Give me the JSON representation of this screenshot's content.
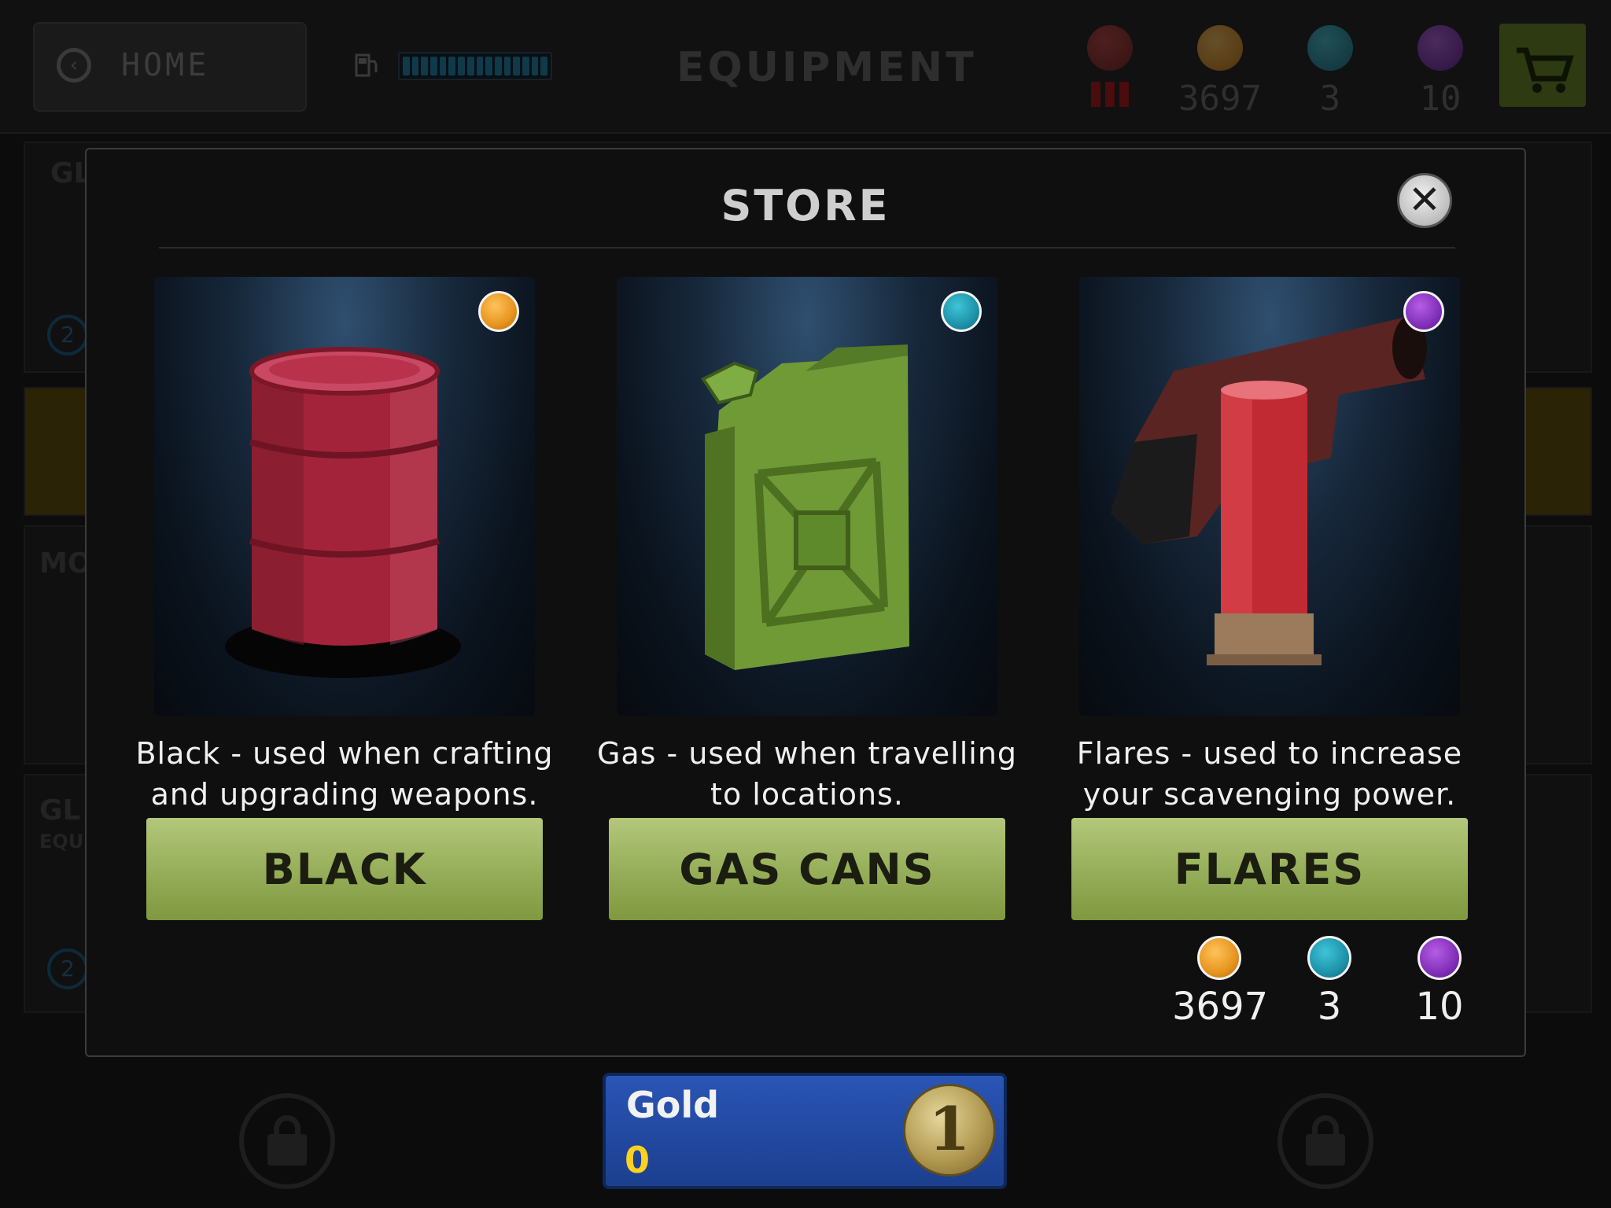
{
  "header": {
    "home_label": "HOME",
    "screen_title": "EQUIPMENT",
    "resources": [
      {
        "icon": "skull-icon",
        "value": ""
      },
      {
        "icon": "black-oil-drop-icon",
        "value": "3697"
      },
      {
        "icon": "gas-can-icon",
        "value": "3"
      },
      {
        "icon": "flare-gun-icon",
        "value": "10"
      }
    ]
  },
  "background": {
    "labels": [
      "GL",
      "MO",
      "GL",
      "EQU"
    ],
    "badge_numbers": [
      "2",
      "2"
    ],
    "gold_panel": {
      "title": "Gold",
      "amount": "0",
      "coin_label": "1"
    }
  },
  "store": {
    "title": "STORE",
    "close_symbol": "✕",
    "cards": [
      {
        "icon": "black-oil-drop-icon",
        "image": "oil-barrel",
        "description_line1": "Black - used when crafting",
        "description_line2": "and upgrading weapons.",
        "button_label": "BLACK"
      },
      {
        "icon": "gas-can-icon",
        "image": "jerry-can",
        "description_line1": "Gas - used when travelling",
        "description_line2": "to locations.",
        "button_label": "GAS CANS"
      },
      {
        "icon": "flare-gun-icon",
        "image": "flare-gun",
        "description_line1": "Flares - used to increase",
        "description_line2": "your scavenging power.",
        "button_label": "FLARES"
      }
    ],
    "balances": [
      {
        "icon": "black-oil-drop-icon",
        "value": "3697"
      },
      {
        "icon": "gas-can-icon",
        "value": "3"
      },
      {
        "icon": "flare-gun-icon",
        "value": "10"
      }
    ]
  },
  "colors": {
    "button_green": "#95ad58",
    "black_resource": "#e6941e",
    "gas_resource": "#1b8ea5",
    "flare_resource": "#7d2cb5",
    "gold_panel_blue": "#2a55b5"
  }
}
